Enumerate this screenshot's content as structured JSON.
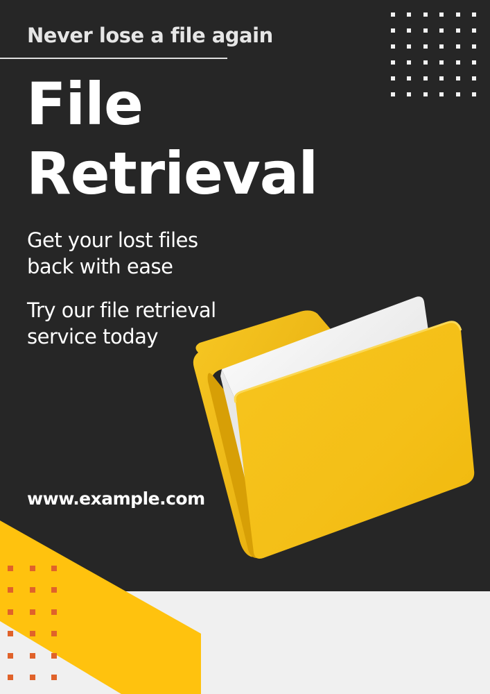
{
  "poster": {
    "tagline": "Never lose a file again",
    "title_line1": "File",
    "title_line2": "Retrieval",
    "subtitle_line1": "Get your lost files",
    "subtitle_line2": "back with ease",
    "cta_line1": "Try our file retrieval",
    "cta_line2": "service today",
    "website": "www.example.com"
  },
  "illustration": {
    "icon": "folder-with-document-icon"
  },
  "colors": {
    "background_dark": "#262626",
    "background_light": "#f0f0f0",
    "accent_yellow": "#ffc20e",
    "folder_yellow": "#f5c21b",
    "dot_orange": "#e0622a",
    "text_primary": "#ffffff"
  }
}
